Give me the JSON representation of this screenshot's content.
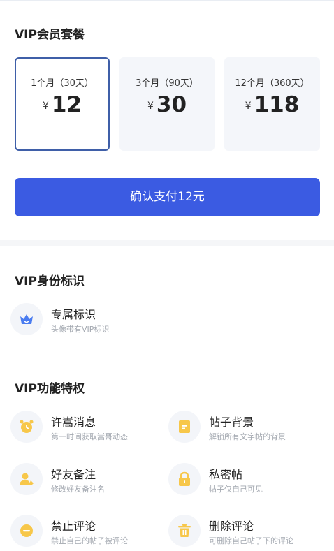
{
  "vip_plans": {
    "title": "VIP会员套餐",
    "plans": [
      {
        "name": "1个月（30天）",
        "currency": "¥",
        "price": "12",
        "selected": true
      },
      {
        "name": "3个月（90天）",
        "currency": "¥",
        "price": "30",
        "selected": false
      },
      {
        "name": "12个月（360天）",
        "currency": "¥",
        "price": "118",
        "selected": false
      }
    ],
    "pay_button": "确认支付12元"
  },
  "identity": {
    "title": "VIP身份标识",
    "items": [
      {
        "title": "专属标识",
        "desc": "头像带有VIP标识",
        "icon": "crown-icon"
      }
    ]
  },
  "privileges": {
    "title": "VIP功能特权",
    "items": [
      {
        "title": "许嵩消息",
        "desc": "第一时间获取嵩哥动态",
        "icon": "alarm-clock-icon"
      },
      {
        "title": "帖子背景",
        "desc": "解锁所有文字帖的背景",
        "icon": "post-background-icon"
      },
      {
        "title": "好友备注",
        "desc": "修改好友备注名",
        "icon": "friend-note-icon"
      },
      {
        "title": "私密帖",
        "desc": "帖子仅自己可见",
        "icon": "lock-icon"
      },
      {
        "title": "禁止评论",
        "desc": "禁止自己的帖子被评论",
        "icon": "no-comment-icon"
      },
      {
        "title": "删除评论",
        "desc": "可删除自己帖子下的评论",
        "icon": "trash-icon"
      }
    ]
  },
  "colors": {
    "accent": "#3b5be2",
    "selected_border": "#3f5fa8",
    "icon_yellow": "#f7c74a",
    "crown_blue": "#4a7cf0"
  }
}
